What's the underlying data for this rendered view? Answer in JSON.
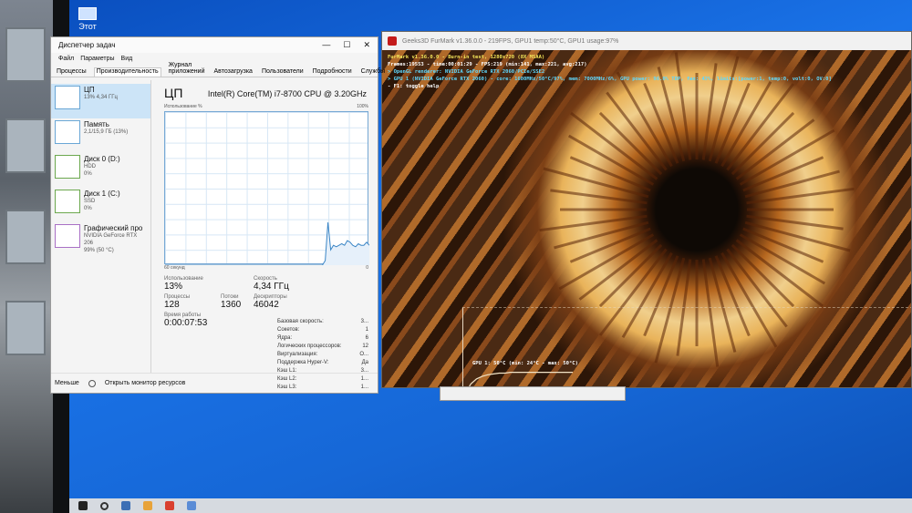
{
  "desktop": {
    "icon_label": "Этот"
  },
  "task_manager": {
    "title": "Диспетчер задач",
    "menu": [
      "Файл",
      "Параметры",
      "Вид"
    ],
    "tabs": [
      "Процессы",
      "Производительность",
      "Журнал приложений",
      "Автозагрузка",
      "Пользователи",
      "Подробности",
      "Службы"
    ],
    "active_tab": "Производительность",
    "sidebar": [
      {
        "title": "ЦП",
        "line1": "13% 4,34 ГГц",
        "line2": "",
        "icon": "cpu-graph-icon"
      },
      {
        "title": "Память",
        "line1": "2,1/15,9 ГБ (13%)",
        "line2": "",
        "icon": "memory-graph-icon"
      },
      {
        "title": "Диск 0 (D:)",
        "line1": "HDD",
        "line2": "0%",
        "icon": "disk-graph-icon"
      },
      {
        "title": "Диск 1 (C:)",
        "line1": "SSD",
        "line2": "0%",
        "icon": "disk-graph-icon"
      },
      {
        "title": "Графический про",
        "line1": "NVIDIA GeForce RTX 206",
        "line2": "99% (50 °C)",
        "icon": "gpu-graph-icon"
      }
    ],
    "main": {
      "heading": "ЦП",
      "cpu_model": "Intel(R) Core(TM) i7-8700 CPU @ 3.20GHz",
      "graph_caption": "Использование %",
      "graph_max": "100%",
      "graph_time": "60 секунд",
      "graph_min": "0",
      "usage_points": [
        0,
        0,
        0,
        0,
        0,
        0,
        0,
        0,
        0,
        0,
        0,
        0,
        0,
        0,
        0,
        0,
        0,
        0,
        0,
        0,
        0,
        0,
        0,
        0,
        0,
        0,
        0,
        0,
        0,
        0,
        0,
        0,
        0,
        0,
        0,
        0,
        0,
        0,
        0,
        0,
        0,
        0,
        0,
        0,
        0,
        0,
        0,
        0,
        0,
        0,
        0,
        0,
        0,
        0,
        0,
        0,
        0,
        0,
        3,
        28,
        10,
        13,
        12,
        13,
        14,
        13,
        16,
        15,
        13,
        12,
        14,
        13,
        13,
        15,
        13
      ]
    },
    "stats": {
      "usage_label": "Использование",
      "usage_value": "13%",
      "speed_label": "Скорость",
      "speed_value": "4,34 ГГц",
      "processes_label": "Процессы",
      "processes_value": "128",
      "threads_label": "Потоки",
      "threads_value": "1360",
      "handles_label": "Дескрипторы",
      "handles_value": "46042",
      "uptime_label": "Время работы",
      "uptime_value": "0:00:07:53"
    },
    "specs": [
      {
        "label": "Базовая скорость:",
        "value": "3..."
      },
      {
        "label": "Сокетов:",
        "value": "1"
      },
      {
        "label": "Ядра:",
        "value": "6"
      },
      {
        "label": "Логических процессоров:",
        "value": "12"
      },
      {
        "label": "Виртуализация:",
        "value": "О..."
      },
      {
        "label": "Поддержка Hyper-V:",
        "value": "Да"
      },
      {
        "label": "Кэш L1:",
        "value": "3..."
      },
      {
        "label": "Кэш L2:",
        "value": "1..."
      },
      {
        "label": "Кэш L3:",
        "value": "1..."
      }
    ],
    "footer": {
      "less_label": "Меньше",
      "monitor_label": "Открыть монитор ресурсов"
    }
  },
  "furmark": {
    "title": "Geeks3D FurMark v1.36.0.0 - 219FPS, GPU1 temp:50°C, GPU1 usage:97%",
    "hud_lines": [
      {
        "text": "FurMark v1.36.0.0 - Burn-in test, 1280x720 (8X MSAA)",
        "color": "yellow"
      },
      {
        "text": "Frames:19553 - time:00:01:29 - FPS:219 (min:141, max:221, avg:217)",
        "color": "white"
      },
      {
        "text": "> OpenGL renderer: NVIDIA GeForce RTX 2060/PCIe/SSE2",
        "color": "cyan"
      },
      {
        "text": "> GPU 1 (NVIDIA GeForce RTX 2060) - core: 1680MHz/50°C/97%, mem: 7000MHz/6%, GPU power: 96.0% TDP, fan: 42%, limits:[power:1, temp:0, volt:0, OV:0]",
        "color": "cyan"
      },
      {
        "text": "- F1: toggle help",
        "color": "white"
      }
    ],
    "temp_label": "GPU 1: 50°C (min: 24°C - max: 50°C)",
    "temp_points": [
      24,
      36,
      42,
      45,
      47,
      48,
      49,
      49,
      50,
      50,
      50,
      50,
      50,
      50,
      50,
      50,
      50,
      50,
      50,
      50
    ]
  },
  "colors": {
    "desktop_blue": "#1a73e8",
    "cpu_graph_line": "#3b86c6",
    "hud_yellow": "#f5e65a",
    "hud_cyan": "#5fd9ff"
  }
}
